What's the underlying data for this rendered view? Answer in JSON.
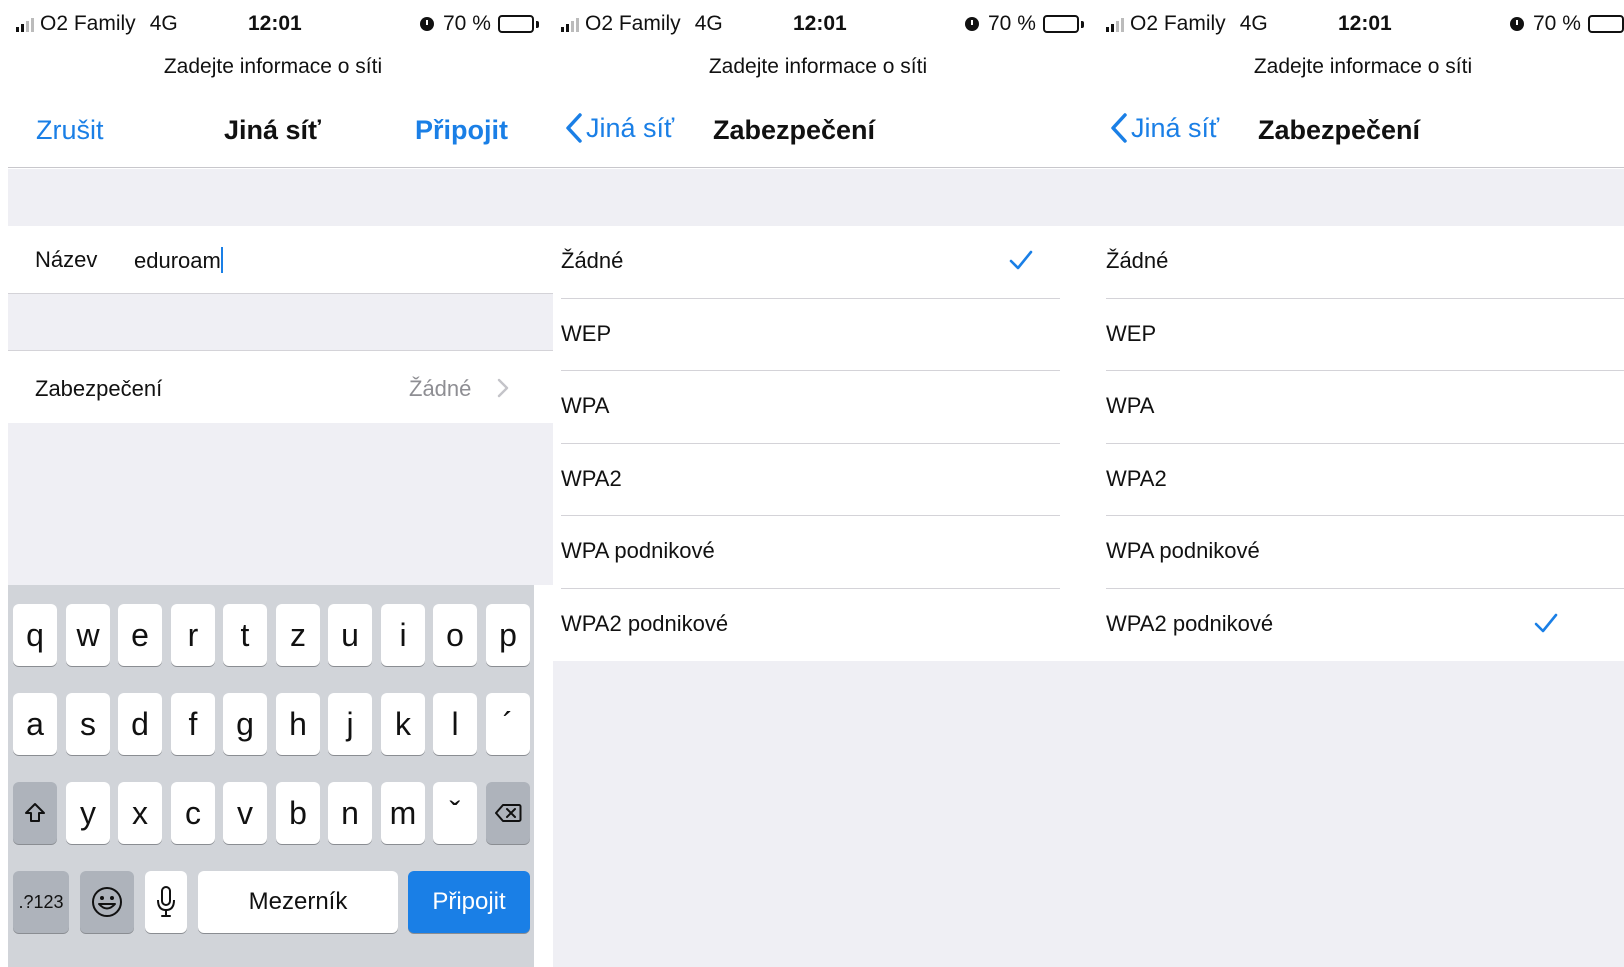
{
  "status_bar": {
    "carrier": "O2 Family",
    "network": "4G",
    "time": "12:01",
    "battery": "70 %",
    "battery_level": 0.7
  },
  "prompt": "Zadejte informace o síti",
  "screen1": {
    "cancel_label": "Zrušit",
    "title": "Jiná síť",
    "connect_label": "Připojit",
    "name_label": "Název",
    "name_value": "eduroam",
    "security_label": "Zabezpečení",
    "security_value": "Žádné"
  },
  "keyboard": {
    "row1": [
      "q",
      "w",
      "e",
      "r",
      "t",
      "z",
      "u",
      "i",
      "o",
      "p"
    ],
    "row2": [
      "a",
      "s",
      "d",
      "f",
      "g",
      "h",
      "j",
      "k",
      "l",
      "´"
    ],
    "row3": [
      "y",
      "x",
      "c",
      "v",
      "b",
      "n",
      "m",
      "ˇ"
    ],
    "numbers_label": ".?123",
    "space_label": "Mezerník",
    "go_label": "Připojit"
  },
  "screen2": {
    "back_label": "Jiná síť",
    "title": "Zabezpečení",
    "options": [
      "Žádné",
      "WEP",
      "WPA",
      "WPA2",
      "WPA podnikové",
      "WPA2 podnikové"
    ],
    "selected": "Žádné"
  },
  "screen3": {
    "back_label": "Jiná síť",
    "title": "Zabezpečení",
    "options": [
      "Žádné",
      "WEP",
      "WPA",
      "WPA2",
      "WPA podnikové",
      "WPA2 podnikové"
    ],
    "selected": "WPA2 podnikové"
  },
  "colors": {
    "accent": "#1a7fe6",
    "grouped_background": "#efeff4",
    "keyboard_background": "#d1d4d9"
  }
}
